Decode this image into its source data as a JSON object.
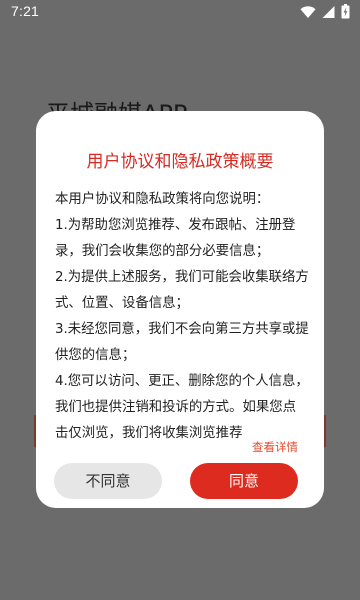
{
  "status_bar": {
    "time": "7:21",
    "icons": [
      "wifi-icon",
      "signal-icon",
      "battery-icon"
    ]
  },
  "background": {
    "app_title": "平城融媒APP"
  },
  "dialog": {
    "title": "用户协议和隐私政策概要",
    "paragraphs": [
      "本用户协议和隐私政策将向您说明：",
      "1.为帮助您浏览推荐、发布跟帖、注册登录，我们会收集您的部分必要信息；",
      "2.为提供上述服务，我们可能会收集联络方式、位置、设备信息；",
      "3.未经您同意，我们不会向第三方共享或提供您的信息；",
      "4.您可以访问、更正、删除您的个人信息，我们也提供注销和投诉的方式。如果您点击仅浏览，我们将收集浏览推荐"
    ],
    "view_details": "查看详情",
    "disagree_label": "不同意",
    "agree_label": "同意"
  },
  "colors": {
    "accent": "#de2b1f",
    "title": "#d62b22",
    "link": "#e84a2c",
    "scrim": "#6b6b6b"
  }
}
